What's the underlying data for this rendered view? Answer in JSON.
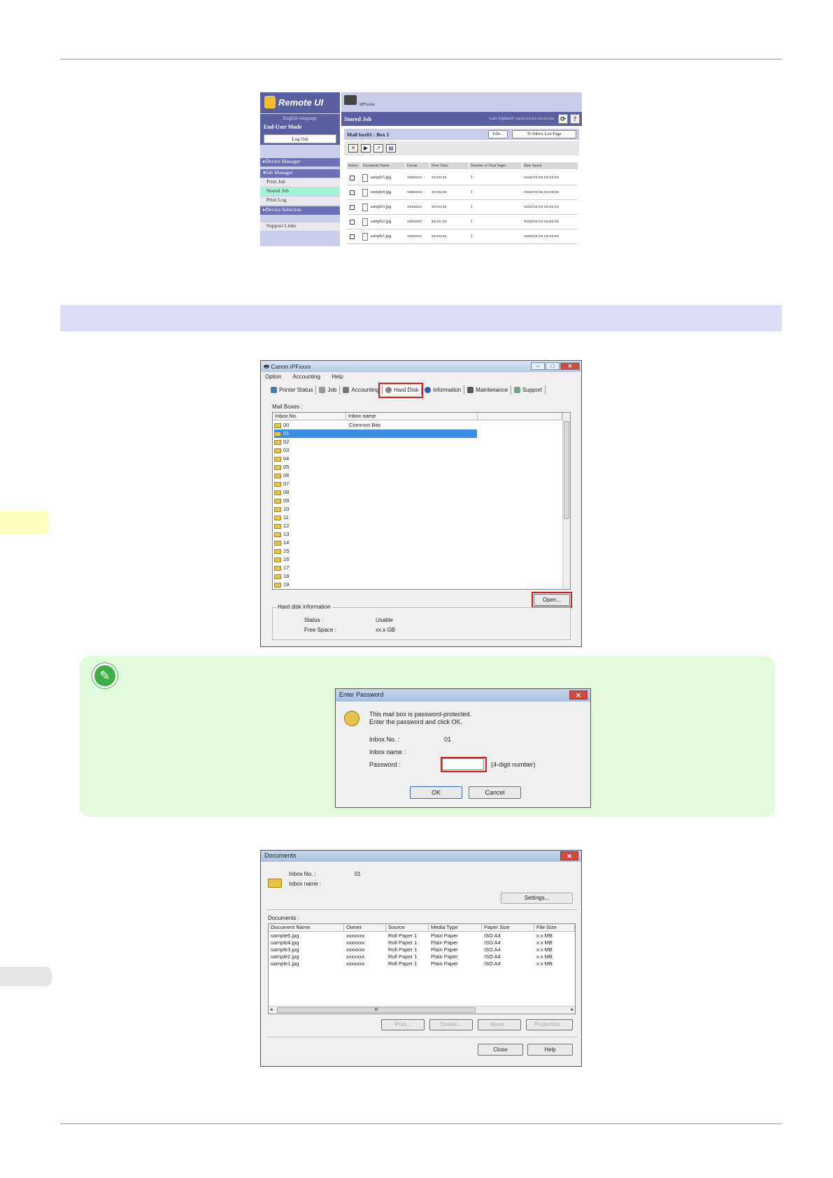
{
  "remote_ui": {
    "logo": "Remote UI",
    "language": "English language",
    "mode": "End-User Mode",
    "logout": "Log Out",
    "nav": {
      "device_manager": "Device Manager",
      "job_manager": "Job Manager",
      "print_job": "Print Job",
      "stored_job": "Stored Job",
      "print_log": "Print Log",
      "device_selection": "Device Selection",
      "support_links": "Support Links"
    },
    "printer_name": "iPFxxxx",
    "page_title": "Stored Job",
    "last_updated": "Last Updated :xxxx/xx/xx xx:xx:xx",
    "refresh_icon": "⟳",
    "help_icon": "?",
    "mailbox_title": "Mail box01 : Box 1",
    "edit_button": "Edit...",
    "inbox_list_button": "To Inbox List Page",
    "tools": [
      "✕",
      "▶",
      "↗",
      "▤"
    ],
    "table_headers": [
      "Select",
      "Document Name",
      "Owner",
      "Print Time",
      "Number of Total Pages",
      "Date Saved"
    ],
    "rows": [
      {
        "name": "sample5.jpg",
        "owner": "xxxxxxx",
        "time": "xx:xx:xx",
        "pages": "1",
        "date": "xxxx/xx/xx xx:xx:xx"
      },
      {
        "name": "sample4.jpg",
        "owner": "xxxxxxx",
        "time": "xx:xx:xx",
        "pages": "1",
        "date": "xxxx/xx/xx xx:xx:xx"
      },
      {
        "name": "sample3.jpg",
        "owner": "xxxxxxx",
        "time": "xx:xx:xx",
        "pages": "1",
        "date": "xxxx/xx/xx xx:xx:xx"
      },
      {
        "name": "sample2.jpg",
        "owner": "xxxxxxx",
        "time": "xx:xx:xx",
        "pages": "1",
        "date": "xxxx/xx/xx xx:xx:xx"
      },
      {
        "name": "sample1.jpg",
        "owner": "xxxxxxx",
        "time": "xx:xx:xx",
        "pages": "1",
        "date": "xxxx/xx/xx xx:xx:xx"
      }
    ]
  },
  "canon_window": {
    "title": "Canon iPFxxxx",
    "menu": [
      "Option",
      "Accounting",
      "Help"
    ],
    "tabs": [
      "Printer Status",
      "Job",
      "Accounting",
      "Hard Disk",
      "Information",
      "Maintenance",
      "Support"
    ],
    "mailboxes_label": "Mail Boxes :",
    "col_inbox_no": "Inbox No.",
    "col_inbox_name": "Inbox name",
    "boxes": [
      {
        "no": "00",
        "name": "Common Box"
      },
      {
        "no": "01",
        "name": ""
      },
      {
        "no": "02",
        "name": ""
      },
      {
        "no": "03",
        "name": ""
      },
      {
        "no": "04",
        "name": ""
      },
      {
        "no": "05",
        "name": ""
      },
      {
        "no": "06",
        "name": ""
      },
      {
        "no": "07",
        "name": ""
      },
      {
        "no": "08",
        "name": ""
      },
      {
        "no": "09",
        "name": ""
      },
      {
        "no": "10",
        "name": ""
      },
      {
        "no": "11",
        "name": ""
      },
      {
        "no": "12",
        "name": ""
      },
      {
        "no": "13",
        "name": ""
      },
      {
        "no": "14",
        "name": ""
      },
      {
        "no": "15",
        "name": ""
      },
      {
        "no": "16",
        "name": ""
      },
      {
        "no": "17",
        "name": ""
      },
      {
        "no": "18",
        "name": ""
      },
      {
        "no": "19",
        "name": ""
      }
    ],
    "open_button": "Open...",
    "hdd_group": "Hard disk information",
    "status_label": "Status :",
    "status_value": "Usable",
    "free_label": "Free Space :",
    "free_value": "xx.x GB"
  },
  "password_dialog": {
    "title": "Enter Password",
    "message1": "This mail box is password-protected.",
    "message2": "Enter the password and click OK.",
    "inbox_no_label": "Inbox No. :",
    "inbox_no_value": "01",
    "inbox_name_label": "Inbox name :",
    "password_label": "Password :",
    "password_value": "",
    "hint": "(4-digit number)",
    "ok": "OK",
    "cancel": "Cancel"
  },
  "documents_window": {
    "title": "Documents",
    "inbox_no_label": "Inbox No. :",
    "inbox_no_value": "01",
    "inbox_name_label": "Inbox name :",
    "settings_button": "Settings...",
    "documents_label": "Documents :",
    "headers": [
      "Document Name",
      "Owner",
      "Source",
      "Media Type",
      "Paper Size",
      "File Size"
    ],
    "rows": [
      [
        "sample5.jpg",
        "xxxxxxx",
        "Roll Paper 1",
        "Plain Paper",
        "ISO A4",
        "x.x MB"
      ],
      [
        "sample4.jpg",
        "xxxxxxx",
        "Roll Paper 1",
        "Plain Paper",
        "ISO A4",
        "x.x MB"
      ],
      [
        "sample3.jpg",
        "xxxxxxx",
        "Roll Paper 1",
        "Plain Paper",
        "ISO A4",
        "x.x MB"
      ],
      [
        "sample2.jpg",
        "xxxxxxx",
        "Roll Paper 1",
        "Plain Paper",
        "ISO A4",
        "x.x MB"
      ],
      [
        "sample1.jpg",
        "xxxxxxx",
        "Roll Paper 1",
        "Plain Paper",
        "ISO A4",
        "x.x MB"
      ]
    ],
    "scroll_mid": "III",
    "print": "Print...",
    "delete": "Delete...",
    "move": "Move...",
    "properties": "Properties...",
    "close": "Close",
    "help": "Help"
  }
}
